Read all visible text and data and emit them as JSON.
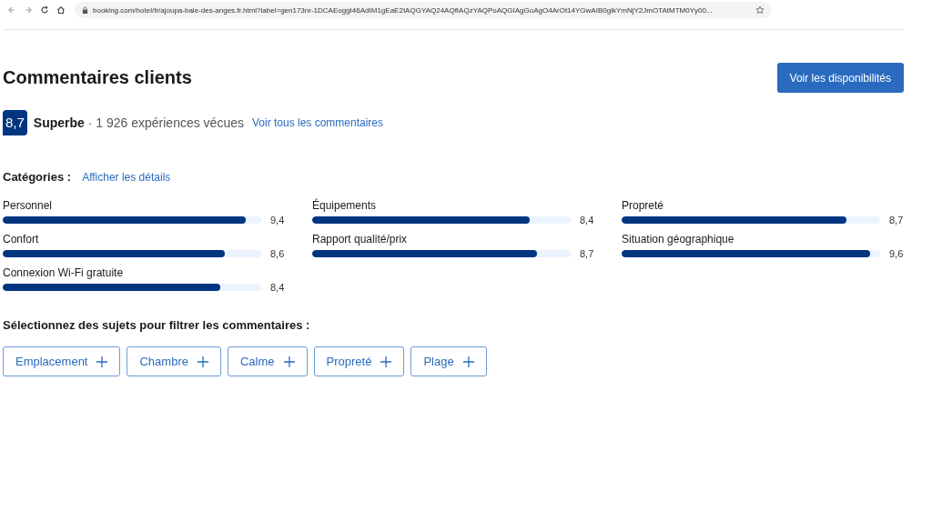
{
  "browser": {
    "url": "booking.com/hotel/fr/ajoupa-baie-des-anges.fr.html?label=gen173nr-1DCAEoggI46AdIM1gEaE2IAQGYAQ24AQfIAQzYAQPoAQGIAgGoAgO4ArOt14YGwAIB0glkYmNjY2JmOTAtMTM0Yy00..."
  },
  "heading": "Commentaires clients",
  "availability_button": "Voir les disponibilités",
  "score": {
    "value": "8,7",
    "rating": "Superbe",
    "count": " · 1 926 expériences vécues",
    "link": "Voir tous les commentaires"
  },
  "categories": {
    "label": "Catégories :",
    "link": "Afficher les détails",
    "items": [
      {
        "name": "Personnel",
        "score": "9,4",
        "level": 0.94
      },
      {
        "name": "Équipements",
        "score": "8,4",
        "level": 0.84
      },
      {
        "name": "Propreté",
        "score": "8,7",
        "level": 0.87
      },
      {
        "name": "Confort",
        "score": "8,6",
        "level": 0.86
      },
      {
        "name": "Rapport qualité/prix",
        "score": "8,7",
        "level": 0.87
      },
      {
        "name": "Situation géographique",
        "score": "9,6",
        "level": 0.96
      },
      {
        "name": "Connexion Wi-Fi gratuite",
        "score": "8,4",
        "level": 0.84
      }
    ]
  },
  "topics": {
    "label": "Sélectionnez des sujets pour filtrer les commentaires :",
    "items": [
      "Emplacement",
      "Chambre",
      "Calme",
      "Propreté",
      "Plage"
    ]
  }
}
